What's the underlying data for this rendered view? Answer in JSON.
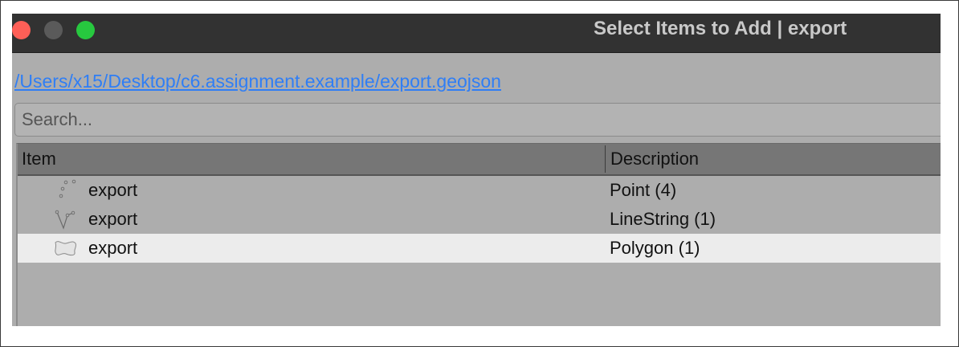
{
  "window": {
    "title": "Select Items to Add | export"
  },
  "file_path": "/Users/x15/Desktop/c6.assignment.example/export.geojson",
  "search": {
    "placeholder": "Search...",
    "value": ""
  },
  "table": {
    "columns": [
      "Item",
      "Description"
    ],
    "rows": [
      {
        "icon": "point-layer-icon",
        "name": "export",
        "description": "Point (4)",
        "selected": false
      },
      {
        "icon": "linestring-layer-icon",
        "name": "export",
        "description": "LineString (1)",
        "selected": false
      },
      {
        "icon": "polygon-layer-icon",
        "name": "export",
        "description": "Polygon (1)",
        "selected": true
      }
    ]
  },
  "colors": {
    "titlebar": "#323232",
    "window_bg": "#adadad",
    "link": "#2f7ef5",
    "selected_row": "#ececec",
    "close": "#fe5f57",
    "maximize": "#27c83f"
  }
}
